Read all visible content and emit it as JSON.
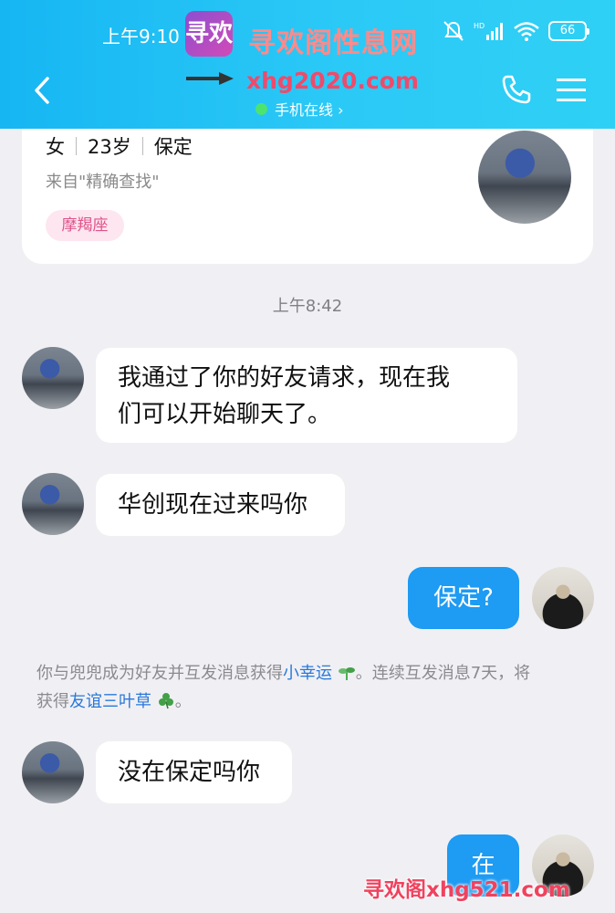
{
  "status_bar": {
    "time": "上午9:10",
    "battery": "66"
  },
  "watermark": {
    "title": "寻欢阁性息网",
    "url": "xhg2020.com",
    "logo_text": "寻欢",
    "bottom": "寻欢阁xhg521.com"
  },
  "header": {
    "online_status": "手机在线 ›"
  },
  "profile": {
    "gender": "女",
    "age": "23岁",
    "city": "保定",
    "source": "来自\"精确查找\"",
    "zodiac": "摩羯座"
  },
  "chat": {
    "timestamp": "上午8:42",
    "messages": [
      {
        "from": "them",
        "lines": [
          "我通过了你的好友请求，现在我",
          "们可以开始聊天了。"
        ]
      },
      {
        "from": "them",
        "text": "华创现在过来吗你"
      },
      {
        "from": "me",
        "text": "保定?"
      },
      {
        "from": "them",
        "text": "没在保定吗你"
      },
      {
        "from": "me",
        "text": "在"
      }
    ],
    "system_notice": {
      "part1": "你与兜兜成为好友并互发消息获得",
      "link1": "小幸运",
      "part2": "。连续互发消息7天，将",
      "part3": "获得",
      "link2": "友谊三叶草",
      "part4": "。"
    }
  },
  "colors": {
    "header": "#16b6f3",
    "bubble_out": "#1e9bf2",
    "link": "#2a78d8",
    "zodiac_bg": "#fde6ef",
    "zodiac_text": "#e0528a"
  },
  "icons": [
    "back-icon",
    "phone-icon",
    "menu-icon",
    "mute-icon",
    "signal-icon",
    "wifi-icon",
    "battery-icon",
    "sprout-icon",
    "clover-icon"
  ]
}
